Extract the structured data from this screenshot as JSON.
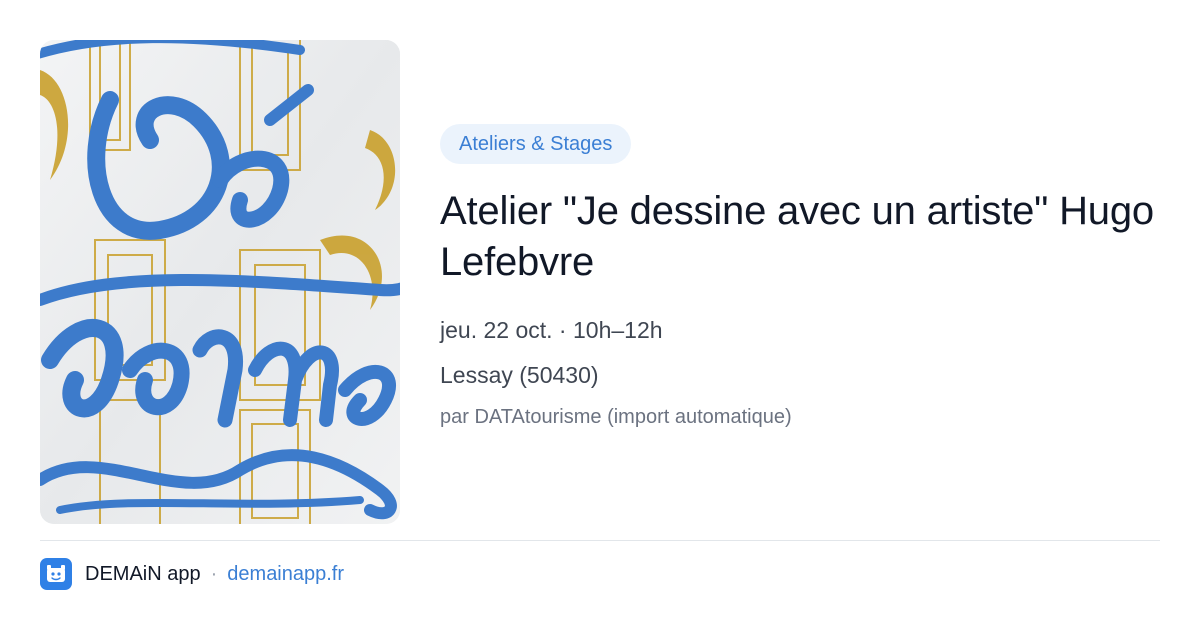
{
  "event": {
    "category": "Ateliers & Stages",
    "title": "Atelier \"Je dessine avec un artiste\" Hugo Lefebvre",
    "date": "jeu. 22 oct.",
    "separator": "·",
    "time": "10h–12h",
    "location": "Lessay (50430)",
    "source": "par DATAtourisme (import automatique)"
  },
  "poster": {
    "artwork_letters": [
      "Dé",
      "forme"
    ],
    "colors": {
      "script": "#3d7bcb",
      "gold": "#c9a02c",
      "paper": "#eef0f1"
    }
  },
  "footer": {
    "app_name": "DEMAiN app",
    "separator": "·",
    "link_text": "demainapp.fr",
    "icon": "demain-app-logo-icon"
  },
  "colors": {
    "accent": "#3b7fd4",
    "tag_bg": "#ebf3fc",
    "title": "#111827",
    "meta": "#3f4652",
    "muted": "#6b7280"
  }
}
